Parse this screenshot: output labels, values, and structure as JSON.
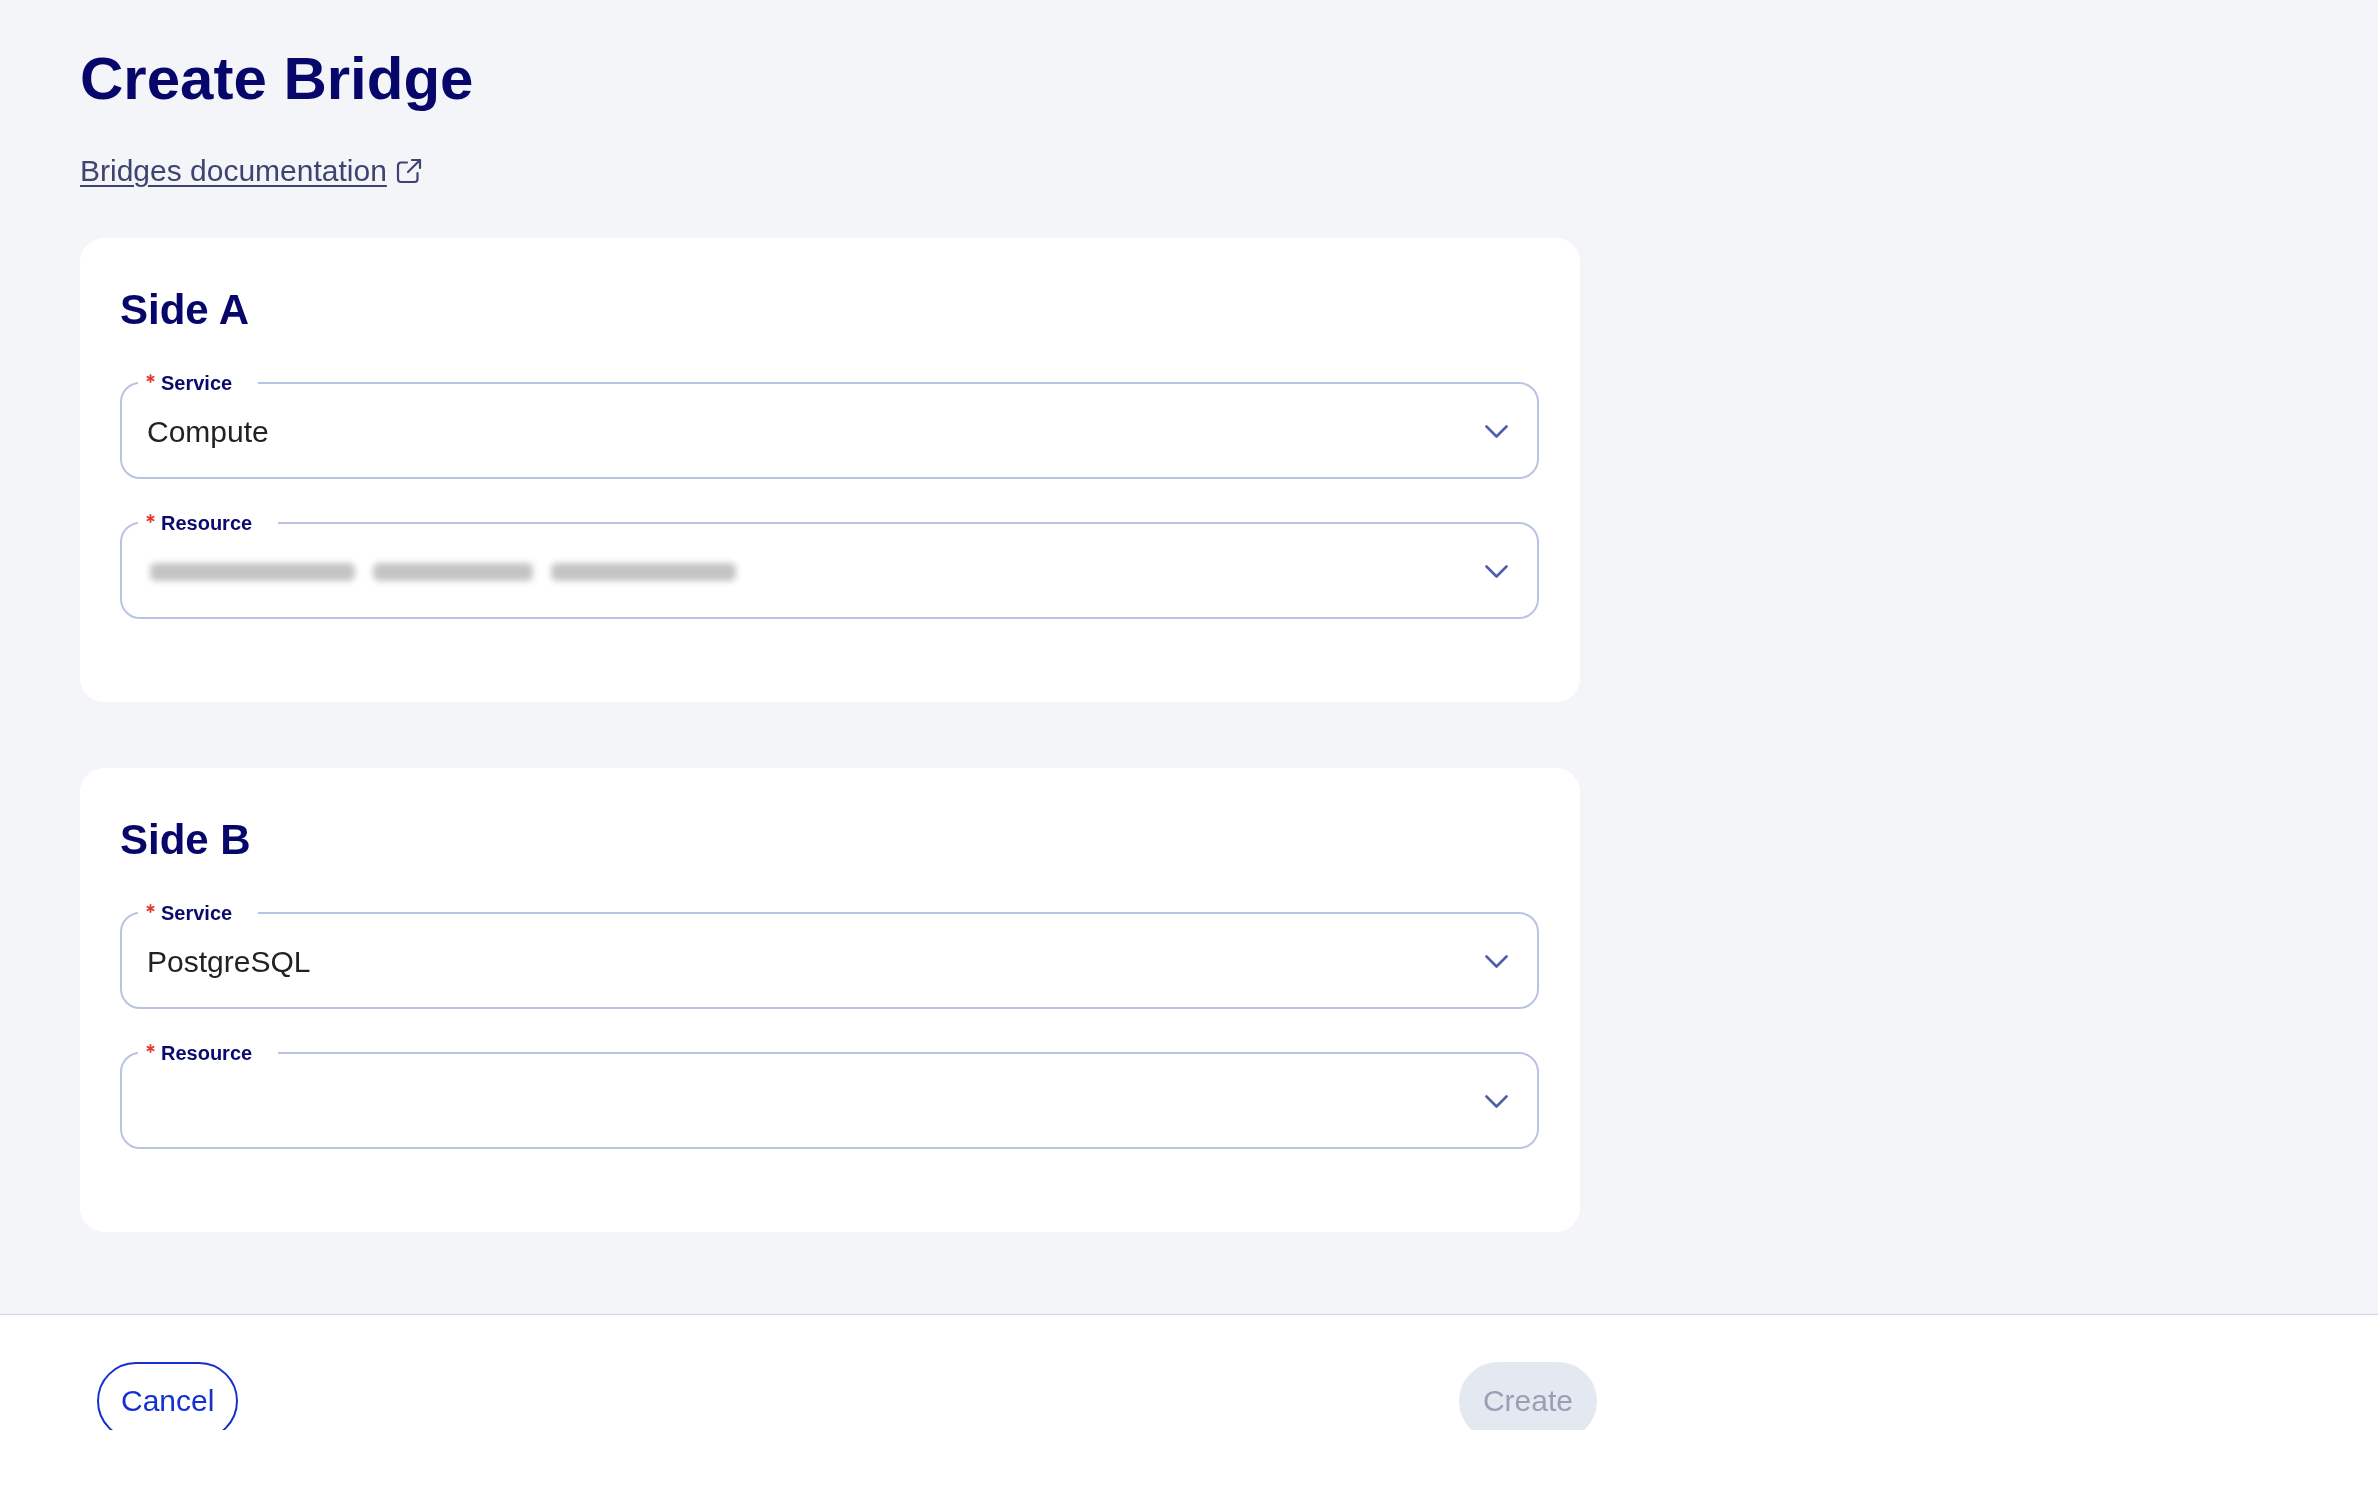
{
  "page": {
    "title": "Create Bridge"
  },
  "documentation_link": {
    "label": "Bridges documentation"
  },
  "sides": [
    {
      "title": "Side A",
      "fields": [
        {
          "label": "Service",
          "required": true,
          "value": "Compute",
          "redacted": false
        },
        {
          "label": "Resource",
          "required": true,
          "redacted": true
        }
      ]
    },
    {
      "title": "Side B",
      "fields": [
        {
          "label": "Service",
          "required": true,
          "value": "PostgreSQL",
          "redacted": false
        },
        {
          "label": "Resource",
          "required": true,
          "redacted": false
        }
      ]
    }
  ],
  "footer": {
    "buttons": [
      {
        "label": "Cancel",
        "kind": "secondary",
        "disabled": false
      },
      {
        "label": "Create",
        "kind": "primary",
        "disabled": true
      }
    ]
  }
}
